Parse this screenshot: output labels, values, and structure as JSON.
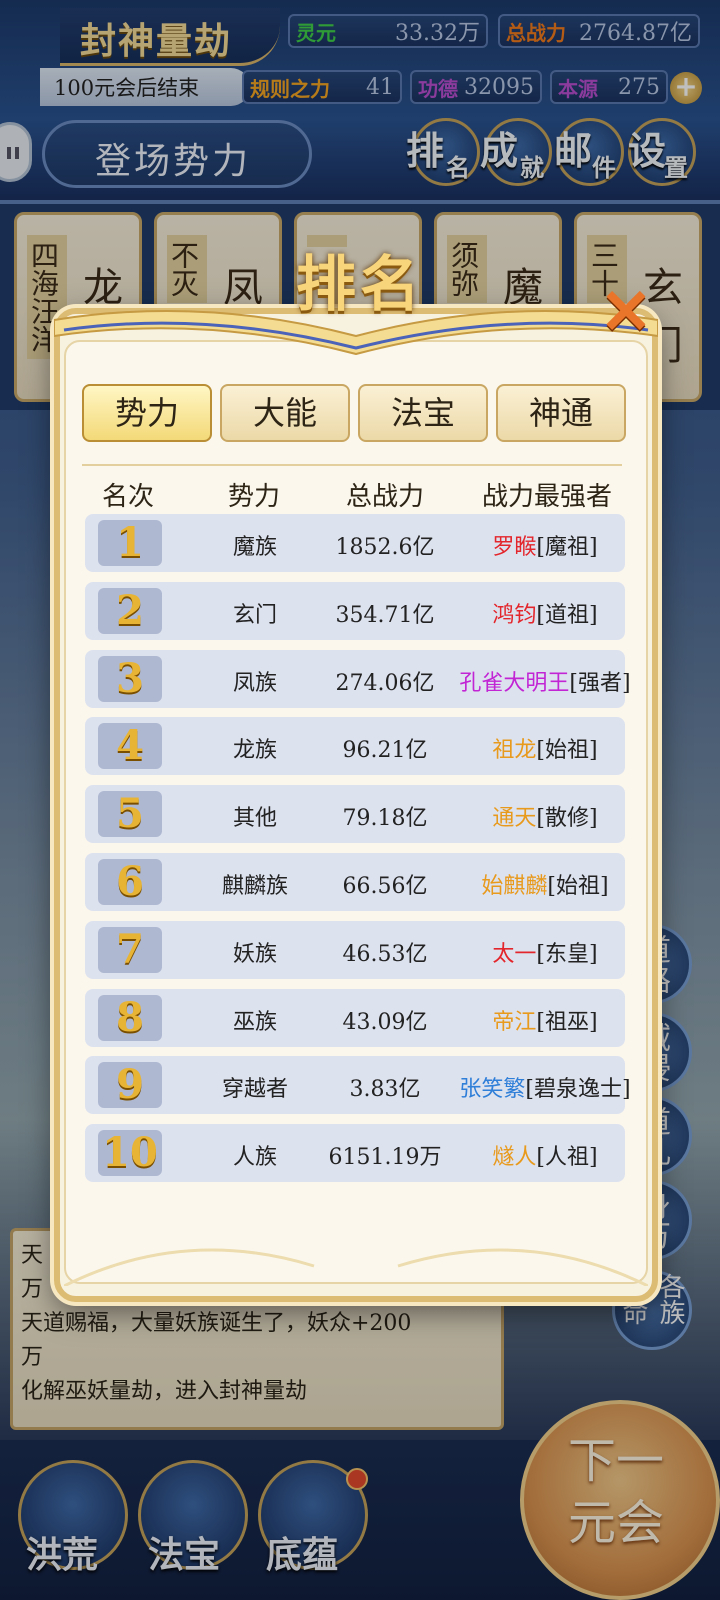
{
  "header": {
    "title": "封神量劫",
    "era_note": "100元会后结束",
    "stats": {
      "lingyuan_label": "灵元",
      "lingyuan_value": "33.32万",
      "total_power_label": "总战力",
      "total_power_value": "2764.87亿",
      "rule_power_label": "规则之力",
      "rule_power_value": "41",
      "merit_label": "功德",
      "merit_value": "32095",
      "origin_label": "本源",
      "origin_value": "275"
    },
    "faction_bar_text": "登场势力",
    "menu": [
      {
        "main": "排",
        "sub": "名"
      },
      {
        "main": "成",
        "sub": "就"
      },
      {
        "main": "邮",
        "sub": "件"
      },
      {
        "main": "设",
        "sub": "置"
      }
    ],
    "plus_label": "+"
  },
  "cards": [
    {
      "side": "四海汪洋",
      "name": "龙"
    },
    {
      "side": "不灭",
      "name": "凤"
    },
    {
      "side": "",
      "name": ""
    },
    {
      "side": "须弥",
      "name": "魔"
    },
    {
      "side": "三十",
      "name": "玄门"
    }
  ],
  "modal": {
    "title": "排名",
    "close_label": "✕",
    "tabs": [
      "势力",
      "大能",
      "法宝",
      "神通"
    ],
    "active_tab": 0,
    "columns": [
      "名次",
      "势力",
      "总战力",
      "战力最强者"
    ],
    "rows": [
      {
        "rank": "1",
        "faction": "魔族",
        "power": "1852.6亿",
        "top": "罗睺",
        "title": "[魔祖]",
        "color": "#e3262b"
      },
      {
        "rank": "2",
        "faction": "玄门",
        "power": "354.71亿",
        "top": "鸿钧",
        "title": "[道祖]",
        "color": "#e3262b"
      },
      {
        "rank": "3",
        "faction": "凤族",
        "power": "274.06亿",
        "top": "孔雀大明王",
        "title": "[强者]",
        "color": "#c125d4"
      },
      {
        "rank": "4",
        "faction": "龙族",
        "power": "96.21亿",
        "top": "祖龙",
        "title": "[始祖]",
        "color": "#e89a1c"
      },
      {
        "rank": "5",
        "faction": "其他",
        "power": "79.18亿",
        "top": "通天",
        "title": "[散修]",
        "color": "#e89a1c"
      },
      {
        "rank": "6",
        "faction": "麒麟族",
        "power": "66.56亿",
        "top": "始麒麟",
        "title": "[始祖]",
        "color": "#e89a1c"
      },
      {
        "rank": "7",
        "faction": "妖族",
        "power": "46.53亿",
        "top": "太一",
        "title": "[东皇]",
        "color": "#e3262b"
      },
      {
        "rank": "8",
        "faction": "巫族",
        "power": "43.09亿",
        "top": "帝江",
        "title": "[祖巫]",
        "color": "#e89a1c"
      },
      {
        "rank": "9",
        "faction": "穿越者",
        "power": "3.83亿",
        "top": "张笑繁",
        "title": "[碧泉逸士]",
        "color": "#2f7fd8"
      },
      {
        "rank": "10",
        "faction": "人族",
        "power": "6151.19万",
        "top": "燧人",
        "title": "[人祖]",
        "color": "#e89a1c"
      }
    ]
  },
  "side_buttons": [
    "道路",
    "域侵",
    "道儿",
    "身万",
    "各族使命"
  ],
  "log": {
    "lines": [
      "天",
      "万",
      "天道赐福，大量妖族诞生了，妖众+200",
      "万",
      "化解巫妖量劫，进入封神量劫"
    ]
  },
  "bottom_nav": [
    "洪荒",
    "法宝",
    "底蕴"
  ],
  "next_era_label": "下一元会",
  "colors": {
    "accent_gold": "#f8d47a",
    "lingyuan_green": "#3fcf4a",
    "power_orange": "#f07a1d",
    "rule_orange": "#f4a622",
    "merit_purple": "#b84fd1",
    "origin_purple": "#b84fd1"
  }
}
